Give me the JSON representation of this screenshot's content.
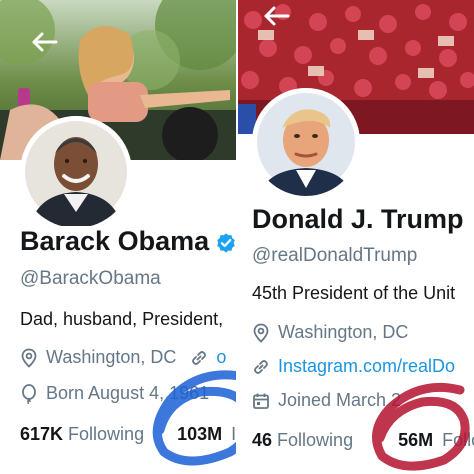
{
  "left_profile": {
    "name": "Barack Obama",
    "handle": "@BarackObama",
    "bio": "Dad, husband, President,",
    "location": "Washington, DC",
    "link_partial": "o",
    "birthday": "Born August 4, 1961",
    "following_count": "617K",
    "following_label": "Following",
    "followers_count": "103M",
    "followers_label_partial": "I"
  },
  "right_profile": {
    "name": "Donald J. Trump",
    "handle": "@realDonaldTrump",
    "bio": "45th President of the Unit",
    "location": "Washington, DC",
    "link": "Instagram.com/realDo",
    "joined": "Joined March 2",
    "following_count": "46",
    "following_label": "Following",
    "followers_count": "56M",
    "followers_label_partial": "Follo"
  },
  "colors": {
    "text_primary": "#14171a",
    "text_secondary": "#657786",
    "link": "#1b95e0",
    "verified_badge": "#1da1f2",
    "blue_scribble": "#1a5fd6",
    "red_scribble": "#b3122e"
  },
  "icons": {
    "back": "arrow-left-icon",
    "verified": "verified-badge-icon",
    "location": "location-pin-icon",
    "link": "link-icon",
    "birthday": "balloon-icon",
    "calendar": "calendar-icon"
  }
}
